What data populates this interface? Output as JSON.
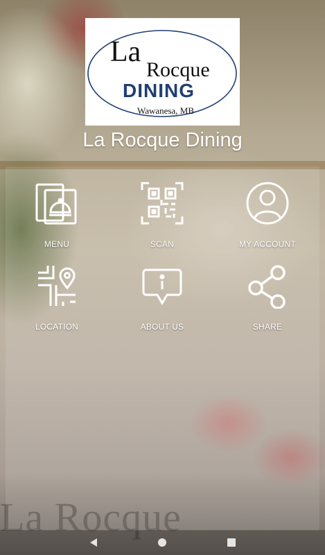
{
  "app": {
    "title": "La Rocque Dining",
    "logo": {
      "line1_la": "La",
      "line1_rocque": "Rocque",
      "line2": "DINING",
      "line3": "Wawanesa, MB"
    }
  },
  "tiles": [
    {
      "label": "MENU",
      "icon": "menu-cloche-icon"
    },
    {
      "label": "SCAN",
      "icon": "qr-code-icon"
    },
    {
      "label": "MY ACCOUNT",
      "icon": "user-account-icon"
    },
    {
      "label": "LOCATION",
      "icon": "map-pin-icon"
    },
    {
      "label": "ABOUT US",
      "icon": "info-bubble-icon"
    },
    {
      "label": "SHARE",
      "icon": "share-icon"
    }
  ],
  "background_text": "La Rocque",
  "navbar": {
    "buttons": [
      "back",
      "home",
      "recents"
    ]
  },
  "colors": {
    "logo_navy": "#1f3f73",
    "text": "#ffffff"
  }
}
